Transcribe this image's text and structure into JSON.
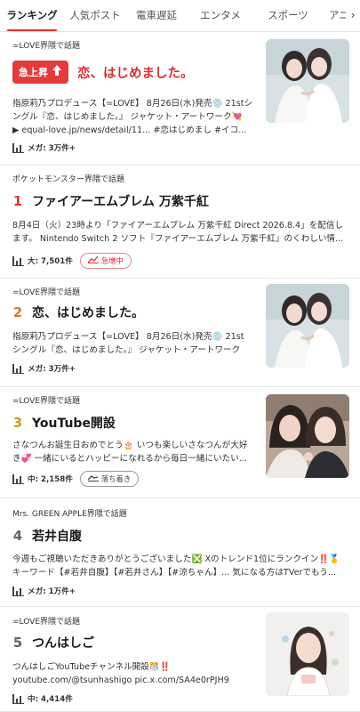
{
  "tabs": [
    "ランキング",
    "人気ポスト",
    "電車遅延",
    "エンタメ",
    "スポーツ",
    "アニメ・"
  ],
  "tab_more_icon": "›",
  "items": [
    {
      "context": "=LOVE界隈で話題",
      "surge_label": "急上昇",
      "title": "恋、はじめました。",
      "desc_line1": "指原莉乃プロデュース【=LOVE】 8月26日(水)発売💿 21stシ",
      "desc_line2": "ングル『恋、はじめました。』 ジャケット・アートワーク💘",
      "desc_line3": "▶ equal-love.jp/news/detail/11... #恋はじめまし #イコ...",
      "volume": "メガ: 3万件+"
    },
    {
      "context": "ポケットモンスター界隈で話題",
      "rank": "1",
      "title": "ファイアーエムブレム 万紫千紅",
      "desc_line1": "8月4日（火）23時より「ファイアーエムブレム 万紫千紅 Direct 2026.8.4」を配信し",
      "desc_line2": "ます。 Nintendo Switch 2 ソフト『ファイアーエムブレム 万紫千紅』のくわしい情...",
      "volume": "大: 7,501件",
      "badge": "急増中"
    },
    {
      "context": "=LOVE界隈で話題",
      "rank": "2",
      "title": "恋、はじめました。",
      "desc_line1": "指原莉乃プロデュース【=LOVE】 8月26日(水)発売💿 21st",
      "desc_line2": "シングル『恋、はじめました。』 ジャケット・アートワーク",
      "volume": "メガ: 3万件+"
    },
    {
      "context": "=LOVE界隈で話題",
      "rank": "3",
      "title": "YouTube開設",
      "desc_line1": "さなつんお誕生日おめでとう🎂 いつも楽しいさなつんが大好",
      "desc_line2": "き💞 一緒にいるとハッピーになれるから毎日一緒にいたい...",
      "volume": "中: 2,158件",
      "badge": "落ち着き"
    },
    {
      "context": "Mrs. GREEN APPLE界隈で話題",
      "rank": "4",
      "title": "若井自腹",
      "desc_line1": "今週もご視聴いただきありがとうございました❎ Xのトレンド1位にランクイン‼️🥇",
      "desc_line2": "キーワード【#若井自腹】【#若井さん】【#涼ちゃん】... 気になる方はTVerでもう...",
      "volume": "メガ: 1万件+"
    },
    {
      "context": "=LOVE界隈で話題",
      "rank": "5",
      "title": "つんはしご",
      "desc_line1": "つんはしごYouTubeチャンネル開設🎊‼️",
      "desc_line2": "youtube.com/@tsunhashigo pic.x.com/SA4e0rPJH9",
      "volume": "中: 4,414件"
    }
  ],
  "icons": {
    "volume": "bar-chart-icon",
    "surge": "arrow-up-icon",
    "hot": "trend-up-icon",
    "calm": "trend-flat-icon"
  },
  "colors": {
    "accent": "#e12d2d",
    "rank1": "#e0392b",
    "rank2": "#e0762b",
    "rank3": "#c89b20",
    "rank_other": "#666666"
  }
}
